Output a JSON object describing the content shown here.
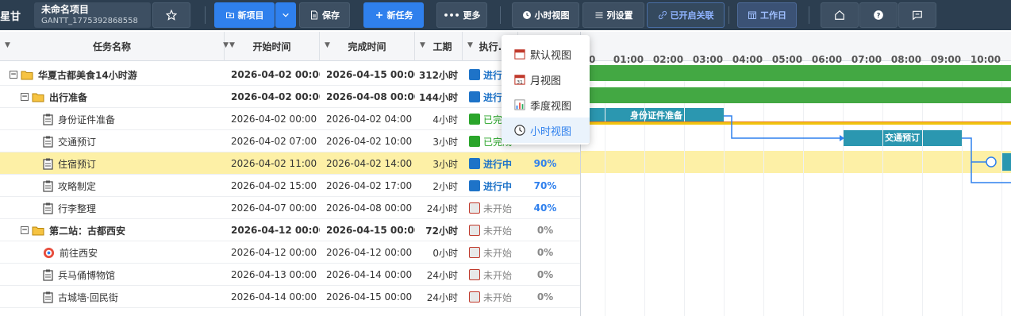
{
  "toolbar": {
    "brand": "星甘",
    "project_name": "未命名项目",
    "project_code": "GANTT_1775392868558",
    "new_project": "新项目",
    "save": "保存",
    "new_task": "新任务",
    "more": "更多",
    "hour_view": "小时视图",
    "column_settings": "列设置",
    "link_enabled": "已开启关联",
    "workday": "工作日"
  },
  "columns": {
    "name": "任务名称",
    "start": "开始时间",
    "end": "完成时间",
    "duration": "工期",
    "exec": "执行..."
  },
  "view_menu": [
    {
      "label": "默认视图",
      "icon": "calendar-icon",
      "active": false
    },
    {
      "label": "月视图",
      "icon": "calendar-31-icon",
      "active": false
    },
    {
      "label": "季度视图",
      "icon": "bar-chart-icon",
      "active": false
    },
    {
      "label": "小时视图",
      "icon": "clock-icon",
      "active": true
    }
  ],
  "timeline": [
    "00",
    "01:00",
    "02:00",
    "03:00",
    "04:00",
    "05:00",
    "06:00",
    "07:00",
    "08:00",
    "09:00",
    "10:00"
  ],
  "tasks": [
    {
      "name": "华夏古都美食14小时游",
      "start": "2026-04-02 00:00",
      "end": "2026-04-15 00:00",
      "duration": "312小时",
      "status": "进行中",
      "pct": "",
      "level": 0,
      "type": "folder",
      "bold": true,
      "expanded": "−"
    },
    {
      "name": "出行准备",
      "start": "2026-04-02 00:00",
      "end": "2026-04-08 00:00",
      "duration": "144小时",
      "status": "进行中",
      "pct": "",
      "level": 1,
      "type": "folder",
      "bold": true,
      "expanded": "−"
    },
    {
      "name": "身份证件准备",
      "start": "2026-04-02 00:00",
      "end": "2026-04-02 04:00",
      "duration": "4小时",
      "status": "已完成",
      "pct": "",
      "level": 2,
      "type": "task",
      "bold": false
    },
    {
      "name": "交通预订",
      "start": "2026-04-02 07:00",
      "end": "2026-04-02 10:00",
      "duration": "3小时",
      "status": "已完成",
      "pct": "",
      "level": 2,
      "type": "task",
      "bold": false
    },
    {
      "name": "住宿预订",
      "start": "2026-04-02 11:00",
      "end": "2026-04-02 14:00",
      "duration": "3小时",
      "status": "进行中",
      "pct": "90%",
      "level": 2,
      "type": "task",
      "bold": false,
      "highlight": true
    },
    {
      "name": "攻略制定",
      "start": "2026-04-02 15:00",
      "end": "2026-04-02 17:00",
      "duration": "2小时",
      "status": "进行中",
      "pct": "70%",
      "level": 2,
      "type": "task",
      "bold": false
    },
    {
      "name": "行李整理",
      "start": "2026-04-07 00:00",
      "end": "2026-04-08 00:00",
      "duration": "24小时",
      "status": "未开始",
      "pct": "40%",
      "level": 2,
      "type": "task",
      "bold": false
    },
    {
      "name": "第二站：古都西安",
      "start": "2026-04-12 00:00",
      "end": "2026-04-15 00:00",
      "duration": "72小时",
      "status": "未开始",
      "pct": "0%",
      "level": 1,
      "type": "folder",
      "bold": true,
      "expanded": "−"
    },
    {
      "name": "前往西安",
      "start": "2026-04-12 00:00",
      "end": "2026-04-12 00:00",
      "duration": "0小时",
      "status": "未开始",
      "pct": "0%",
      "level": 2,
      "type": "milestone",
      "bold": false
    },
    {
      "name": "兵马俑博物馆",
      "start": "2026-04-13 00:00",
      "end": "2026-04-14 00:00",
      "duration": "24小时",
      "status": "未开始",
      "pct": "0%",
      "level": 2,
      "type": "task",
      "bold": false
    },
    {
      "name": "古城墙·回民街",
      "start": "2026-04-14 00:00",
      "end": "2026-04-15 00:00",
      "duration": "24小时",
      "status": "未开始",
      "pct": "0%",
      "level": 2,
      "type": "task",
      "bold": false
    }
  ],
  "gantt_labels": {
    "bar_id": "身份证件准备",
    "bar_traffic": "交通预订"
  },
  "colors": {
    "toolbar_bg": "#2c3e50",
    "accent_blue": "#2f80ed",
    "bar_green": "#43a843",
    "bar_teal": "#2b97b0",
    "row_highlight": "#fdf0a6"
  }
}
